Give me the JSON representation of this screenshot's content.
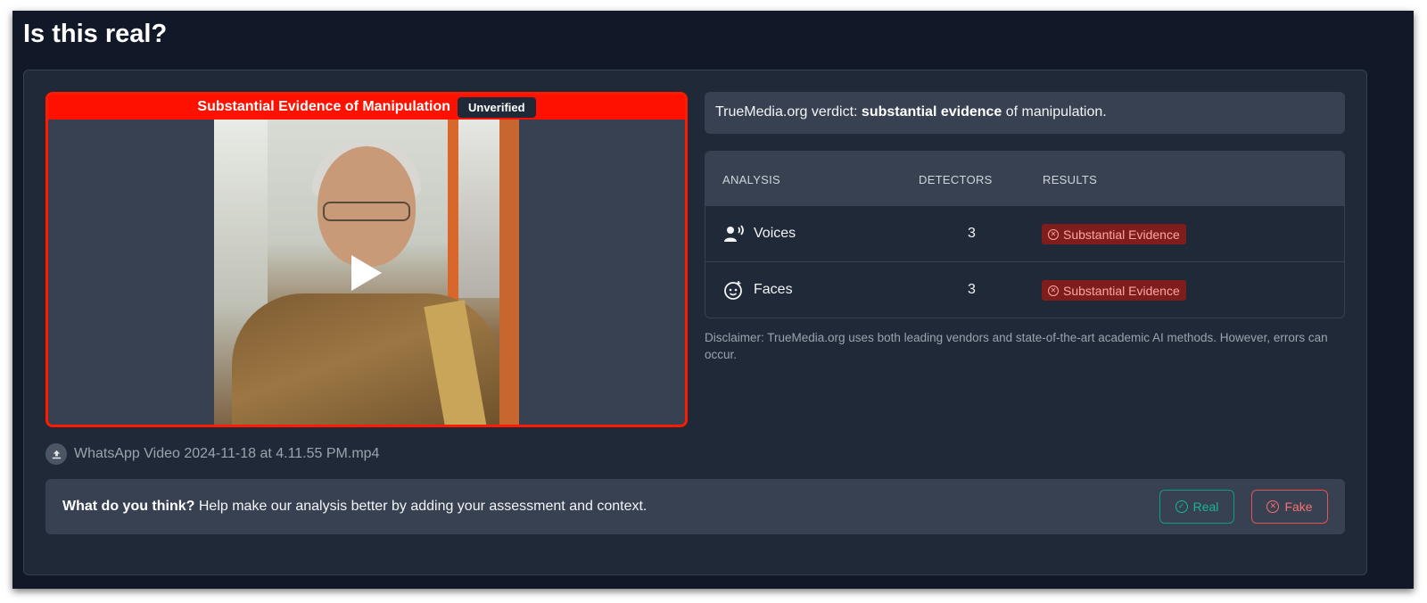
{
  "page": {
    "title": "Is this real?"
  },
  "video": {
    "banner_text": "Substantial Evidence of Manipulation",
    "badge": "Unverified",
    "frame_color": "#ff1a00",
    "play_icon": "play-icon"
  },
  "file": {
    "icon": "upload-icon",
    "name": "WhatsApp Video 2024-11-18 at 4.11.55 PM.mp4"
  },
  "verdict": {
    "prefix": "TrueMedia.org verdict: ",
    "strong": "substantial evidence",
    "suffix": " of manipulation."
  },
  "analysis_table": {
    "headers": [
      "ANALYSIS",
      "DETECTORS",
      "RESULTS"
    ],
    "rows": [
      {
        "icon": "voice-icon",
        "label": "Voices",
        "detectors": "3",
        "result": "Substantial Evidence"
      },
      {
        "icon": "face-icon",
        "label": "Faces",
        "detectors": "3",
        "result": "Substantial Evidence"
      }
    ],
    "result_color": "#7f1d1d"
  },
  "disclaimer": "Disclaimer: TrueMedia.org uses both leading vendors and state-of-the-art academic AI methods. However, errors can occur.",
  "feedback": {
    "strong": "What do you think?",
    "text": " Help make our analysis better by adding your assessment and context.",
    "real_label": "Real",
    "fake_label": "Fake",
    "real_color": "#14b892",
    "fake_color": "#f87171"
  }
}
